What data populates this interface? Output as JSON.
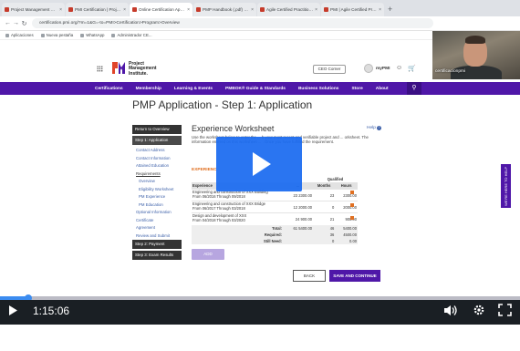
{
  "browser": {
    "tabs": [
      {
        "label": "Project Management Certificati"
      },
      {
        "label": "PMI Certification | Project Mana"
      },
      {
        "label": "Online Certification Applicatio"
      },
      {
        "label": "PMP Handbook (.pdf) (PDF) - 55 kb"
      },
      {
        "label": "Agile Certified Practitioner | PMI"
      },
      {
        "label": "PMI | Agile Certified Practitioner"
      }
    ],
    "active_tab": 2,
    "url": "certification.pmi.org/?m=1&G=-to=PMI>Certification>Program>Overview",
    "bookmarks": [
      "Aplicaciones",
      "Nueva pestaña",
      "WhatsApp",
      "Administrador CE..."
    ]
  },
  "webcam": {
    "caption": "certificacionpmi"
  },
  "site": {
    "logo_lines": [
      "Project",
      "Management",
      "Institute."
    ],
    "ceo_button": "CEO Corner",
    "mypmi": "myPMI",
    "nav": [
      "Certifications",
      "Membership",
      "Learning & Events",
      "PMBOK® Guide & Standards",
      "Business Solutions",
      "Store",
      "About"
    ]
  },
  "page": {
    "title": "PMP Application - Step 1: Application",
    "left_nav": [
      {
        "label": "Return to Overview",
        "kind": "dark"
      },
      {
        "label": "Step 1: Application",
        "kind": "dark"
      },
      {
        "label": "Contact Address",
        "kind": "link"
      },
      {
        "label": "Contact Information",
        "kind": "link"
      },
      {
        "label": "Attained Education",
        "kind": "link"
      },
      {
        "label": "Requirements",
        "kind": "current"
      },
      {
        "label": "Overview",
        "kind": "sub"
      },
      {
        "label": "Eligibility Worksheet",
        "kind": "sub"
      },
      {
        "label": "PM Experience",
        "kind": "sub"
      },
      {
        "label": "PM Education",
        "kind": "sub"
      },
      {
        "label": "Optional Information",
        "kind": "link"
      },
      {
        "label": "Certificate",
        "kind": "link"
      },
      {
        "label": "Agreement",
        "kind": "link"
      },
      {
        "label": "Review and Submit",
        "kind": "link"
      },
      {
        "label": "Step 2: Payment",
        "kind": "dark"
      },
      {
        "label": "Step 3: Exam Results",
        "kind": "dark"
      }
    ],
    "worksheet_title": "Experience Worksheet",
    "help_label": "Help",
    "intro_text": "Use the worksheet below to enter the ... h your most recent and verifiable project and ... orksheet. The information entered on this worksheet ... . Once you have fulfilled the requirement.",
    "experience_heading": "EXPERIENC",
    "table": {
      "qualified_label": "Qualified",
      "headers": [
        "Experience",
        "...",
        "Months",
        "Hours"
      ],
      "rows": [
        {
          "project": "Engineering and construction of XXX Building",
          "dates": "From 06/2016 Through 09/2018",
          "months_a": "23",
          "hours_a": "2300.00",
          "months_q": "23",
          "hours_q": "2300.00"
        },
        {
          "project": "Engineering and construction of XXX Bridge",
          "dates": "From 06/2017 Through 03/2018",
          "months_a": "12",
          "hours_a": "2000.00",
          "months_q": "0",
          "hours_q": "2000.00"
        },
        {
          "project": "Design and development of XXX",
          "dates": "From 04/2018 Through 03/2020",
          "months_a": "24",
          "hours_a": "900.00",
          "months_q": "21",
          "hours_q": "900.00"
        }
      ],
      "totals": [
        {
          "label": "Total:",
          "a": "61",
          "b": "5400.00",
          "c": "46",
          "d": "5400.00"
        },
        {
          "label": "Required:",
          "a": "",
          "b": "",
          "c": "36",
          "d": "4500.00"
        },
        {
          "label": "Still Need:",
          "a": "",
          "b": "",
          "c": "0",
          "d": "0.00"
        }
      ]
    },
    "add_button": "ADD",
    "back_button": "BACK",
    "save_button": "SAVE AND CONTINUE",
    "side_tab": "WE'RE HERE TO HELP"
  },
  "player": {
    "time": "1:15:06",
    "progress": 0.055,
    "colors": {
      "accent": "#3b8cf0",
      "bar": "#1a1f24",
      "pmi_purple": "#4f17a8"
    }
  }
}
